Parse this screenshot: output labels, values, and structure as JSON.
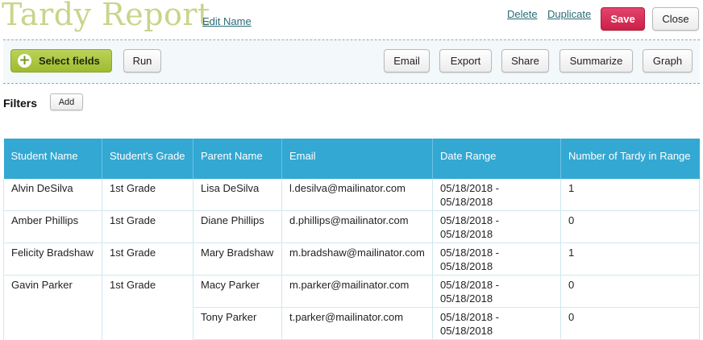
{
  "header": {
    "title": "Tardy Report",
    "edit_name": "Edit Name",
    "delete": "Delete",
    "duplicate": "Duplicate",
    "save": "Save",
    "close": "Close"
  },
  "toolbar": {
    "select_fields": "Select fields",
    "run": "Run",
    "email": "Email",
    "export": "Export",
    "share": "Share",
    "summarize": "Summarize",
    "graph": "Graph"
  },
  "filters": {
    "label": "Filters",
    "add": "Add"
  },
  "table": {
    "headers": [
      "Student Name",
      "Student's Grade",
      "Parent Name",
      "Email",
      "Date Range",
      "Number of Tardy in Range"
    ],
    "rows": [
      [
        "Alvin DeSilva",
        "1st Grade",
        "Lisa DeSilva",
        "l.desilva@mailinator.com",
        "05/18/2018 - 05/18/2018",
        "1"
      ],
      [
        "Amber Phillips",
        "1st Grade",
        "Diane Phillips",
        "d.phillips@mailinator.com",
        "05/18/2018 - 05/18/2018",
        "0"
      ],
      [
        "Felicity Bradshaw",
        "1st Grade",
        "Mary Bradshaw",
        "m.bradshaw@mailinator.com",
        "05/18/2018 - 05/18/2018",
        "1"
      ],
      [
        "Gavin Parker",
        "1st Grade",
        "Macy Parker",
        "m.parker@mailinator.com",
        "05/18/2018 - 05/18/2018",
        "0"
      ],
      [
        "",
        "",
        "Tony Parker",
        "t.parker@mailinator.com",
        "05/18/2018 - 05/18/2018",
        "0"
      ]
    ]
  },
  "colors": {
    "title": "#c9d48a",
    "link": "#2a6b78",
    "save": "#d52a52",
    "select_fields": "#a8c23c",
    "table_header": "#33a8d3"
  },
  "icons": {
    "select_fields": "plus-circle-icon"
  }
}
